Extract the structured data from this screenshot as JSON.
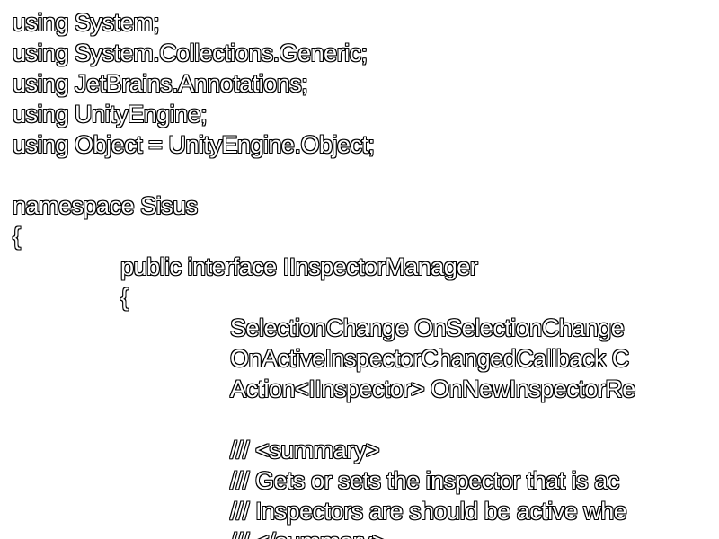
{
  "code": {
    "lines": [
      "using System;",
      "using System.Collections.Generic;",
      "using JetBrains.Annotations;",
      "using UnityEngine;",
      "using Object = UnityEngine.Object;",
      "",
      "namespace Sisus",
      "{",
      "public interface IInspectorManager",
      "{",
      "SelectionChange OnSelectionChange",
      "OnActiveInspectorChangedCallback C",
      "Action<IInspector> OnNewInspectorRe",
      "",
      "/// <summary>",
      "/// Gets or sets the inspector that is ac",
      "/// Inspectors are should be active whe",
      "/// </summary>"
    ]
  }
}
